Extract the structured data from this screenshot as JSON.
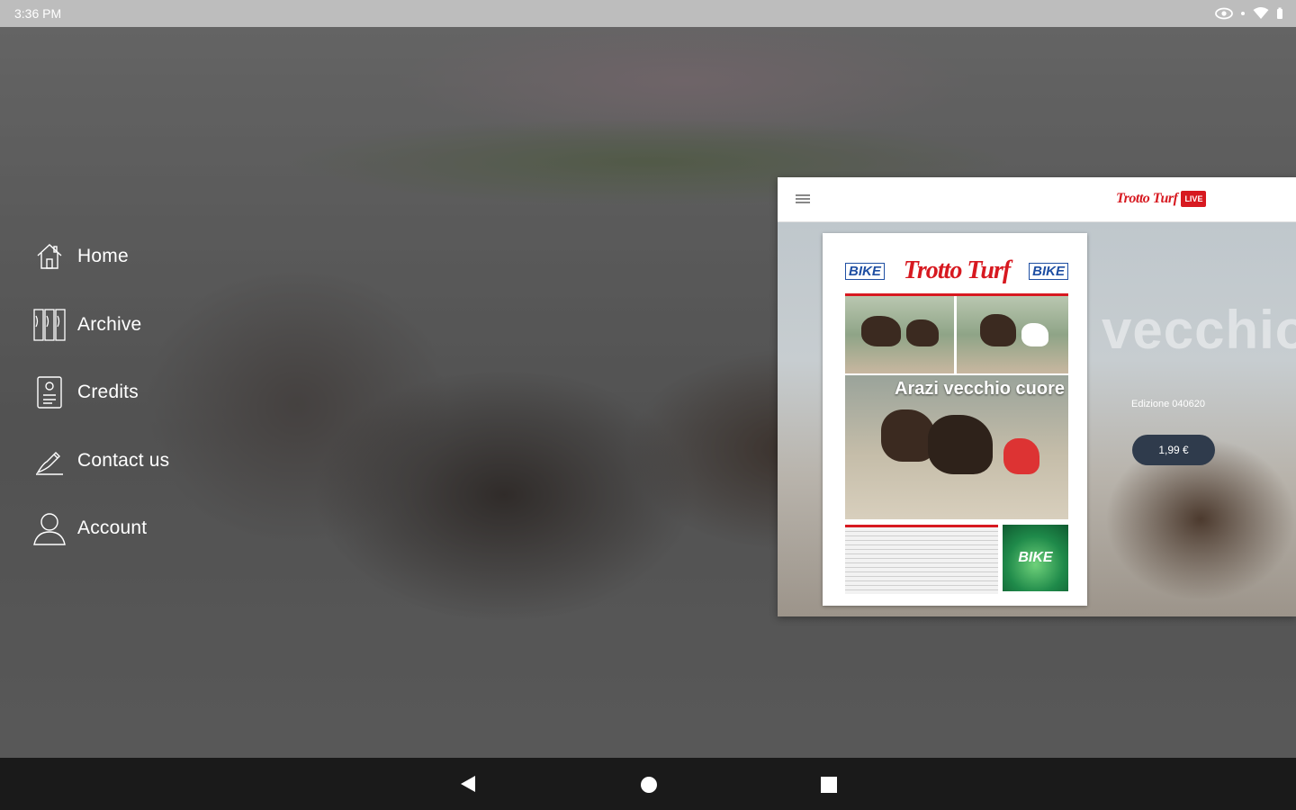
{
  "status_bar": {
    "time": "3:36 PM",
    "icons": [
      "eye-icon",
      "dot-icon",
      "wifi-icon",
      "battery-icon"
    ]
  },
  "menu": {
    "items": [
      {
        "label": "Home",
        "icon": "home-icon"
      },
      {
        "label": "Archive",
        "icon": "archive-icon"
      },
      {
        "label": "Credits",
        "icon": "credits-icon"
      },
      {
        "label": "Contact us",
        "icon": "contact-icon"
      },
      {
        "label": "Account",
        "icon": "account-icon"
      }
    ]
  },
  "preview": {
    "logo_text": "Trotto Turf",
    "logo_badge": "LIVE",
    "edition": "Edizione 040620",
    "price": "1,99 €",
    "background_word": "vecchio",
    "cover": {
      "brand_left": "BIKE",
      "title": "Trotto Turf",
      "brand_right": "BIKE",
      "headline": "Arazi vecchio cuore",
      "bottom_tile": "BIKE"
    }
  },
  "colors": {
    "brand_red": "#d71920",
    "price_button": "#2f3b4c",
    "nav_bar": "#1a1a1a",
    "status_bar": "#bdbdbd"
  },
  "nav_bar": {
    "buttons": [
      "back-icon",
      "home-circle-icon",
      "recents-square-icon"
    ]
  }
}
